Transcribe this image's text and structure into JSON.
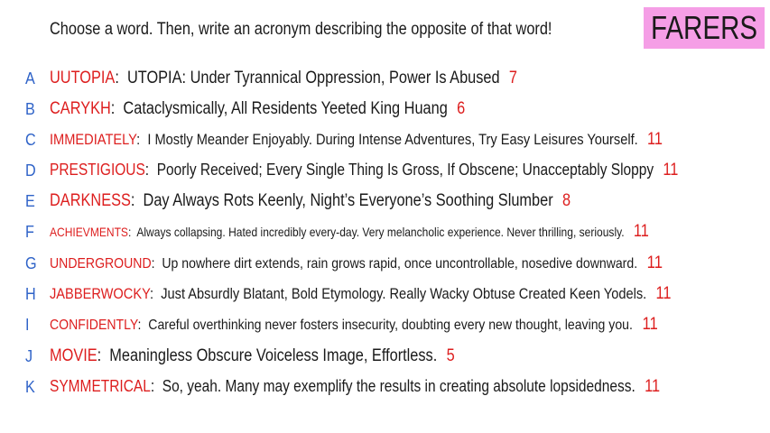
{
  "prompt": "Choose a word. Then, write an acronym describing the opposite of that word!",
  "badge": "FARERS",
  "entries": [
    {
      "letter": "A",
      "word": "UUTOPIA",
      "phrase": "UTOPIA: Under Tyrannical Oppression, Power Is Abused",
      "count": "7"
    },
    {
      "letter": "B",
      "word": "CARYKH",
      "phrase": "Cataclysmically, All Residents Yeeted King Huang",
      "count": "6"
    },
    {
      "letter": "C",
      "word": "IMMEDIATELY",
      "phrase": "I Mostly Meander Enjoyably. During Intense Adventures, Try Easy Leisures Yourself.",
      "count": "11"
    },
    {
      "letter": "D",
      "word": "PRESTIGIOUS",
      "phrase": "Poorly Received; Every Single Thing Is Gross, If Obscene; Unacceptably Sloppy",
      "count": "11"
    },
    {
      "letter": "E",
      "word": "DARKNESS",
      "phrase": "Day Always Rots Keenly, Night’s Everyone’s Soothing Slumber",
      "count": "8"
    },
    {
      "letter": "F",
      "word": "ACHIEVMENTS",
      "phrase": "Always collapsing. Hated incredibly every-day. Very melancholic experience. Never thrilling, seriously.",
      "count": "11"
    },
    {
      "letter": "G",
      "word": "UNDERGROUND",
      "phrase": "Up nowhere dirt extends, rain grows rapid, once uncontrollable, nosedive downward.",
      "count": "11"
    },
    {
      "letter": "H",
      "word": "JABBERWOCKY",
      "phrase": "Just Absurdly Blatant, Bold Etymology. Really Wacky Obtuse Created Keen Yodels.",
      "count": "11"
    },
    {
      "letter": "I",
      "word": "CONFIDENTLY",
      "phrase": "Careful overthinking never fosters insecurity, doubting every new thought, leaving you.",
      "count": "11"
    },
    {
      "letter": "J",
      "word": "MOVIE",
      "phrase": "Meaningless Obscure Voiceless Image, Effortless.",
      "count": "5"
    },
    {
      "letter": "K",
      "word": "SYMMETRICAL",
      "phrase": "So, yeah. Many may exemplify the results in creating absolute lopsidedness.",
      "count": "11"
    }
  ]
}
